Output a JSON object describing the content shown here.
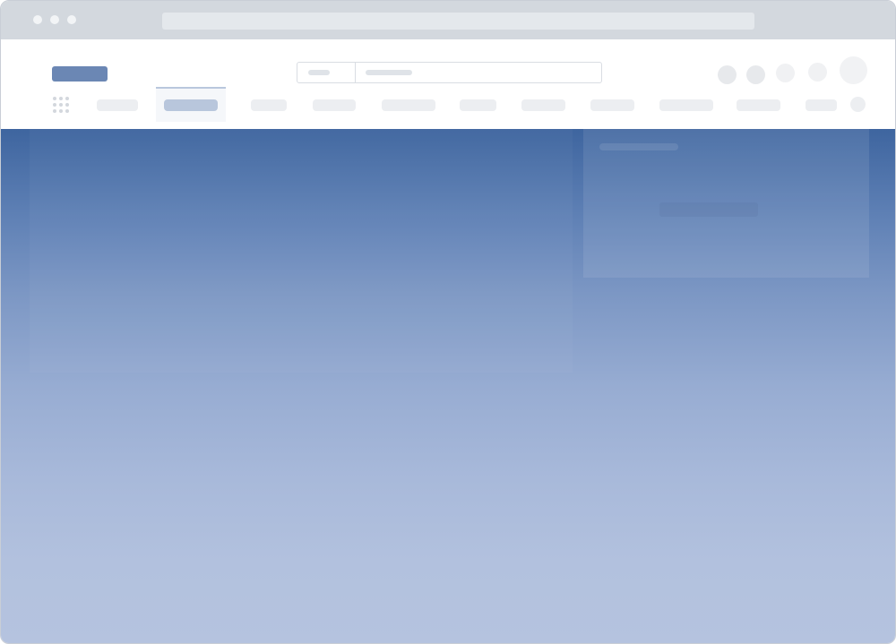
{
  "window": {
    "title": ""
  },
  "chrome": {
    "dots": [
      "close",
      "minimize",
      "maximize"
    ],
    "url": ""
  },
  "header": {
    "logo_text": "",
    "search": {
      "scope_value": "",
      "placeholder": ""
    },
    "nav": {
      "active_index": 1,
      "items": [
        "",
        "",
        "",
        "",
        "",
        "",
        "",
        "",
        "",
        "",
        ""
      ]
    },
    "icons": [
      "account-icon",
      "notifications-icon",
      "help-icon",
      "settings-icon",
      "avatar"
    ]
  },
  "hero": {
    "colors": {
      "top": "#3e659f",
      "bottom": "#b5c3df"
    },
    "panel_title": ""
  }
}
